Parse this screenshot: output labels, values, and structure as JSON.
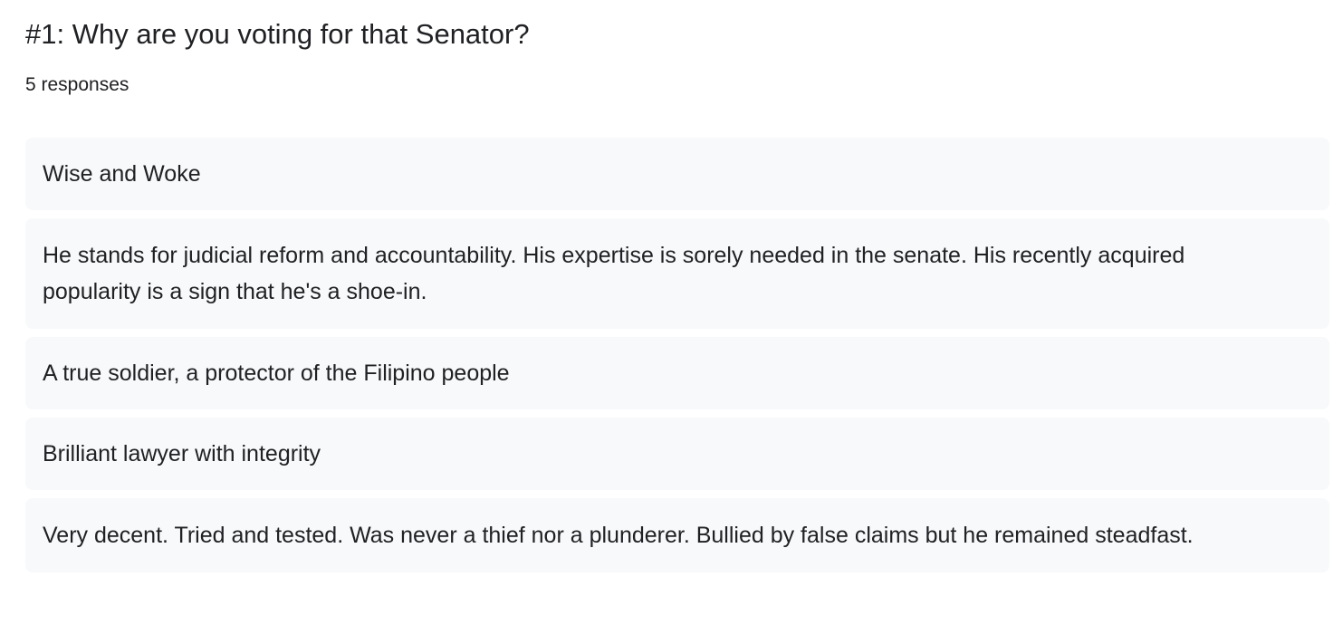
{
  "question": {
    "title": "#1: Why are you voting for that Senator?",
    "response_count": "5 responses"
  },
  "responses": [
    "Wise and Woke",
    "He stands for judicial reform and accountability. His expertise is sorely needed in the senate. His recently acquired popularity is a sign that he's a shoe-in.",
    "A true soldier, a protector of the Filipino people",
    "Brilliant lawyer with integrity",
    "Very decent. Tried and tested. Was never a thief nor a plunderer. Bullied by false claims but he remained steadfast."
  ]
}
